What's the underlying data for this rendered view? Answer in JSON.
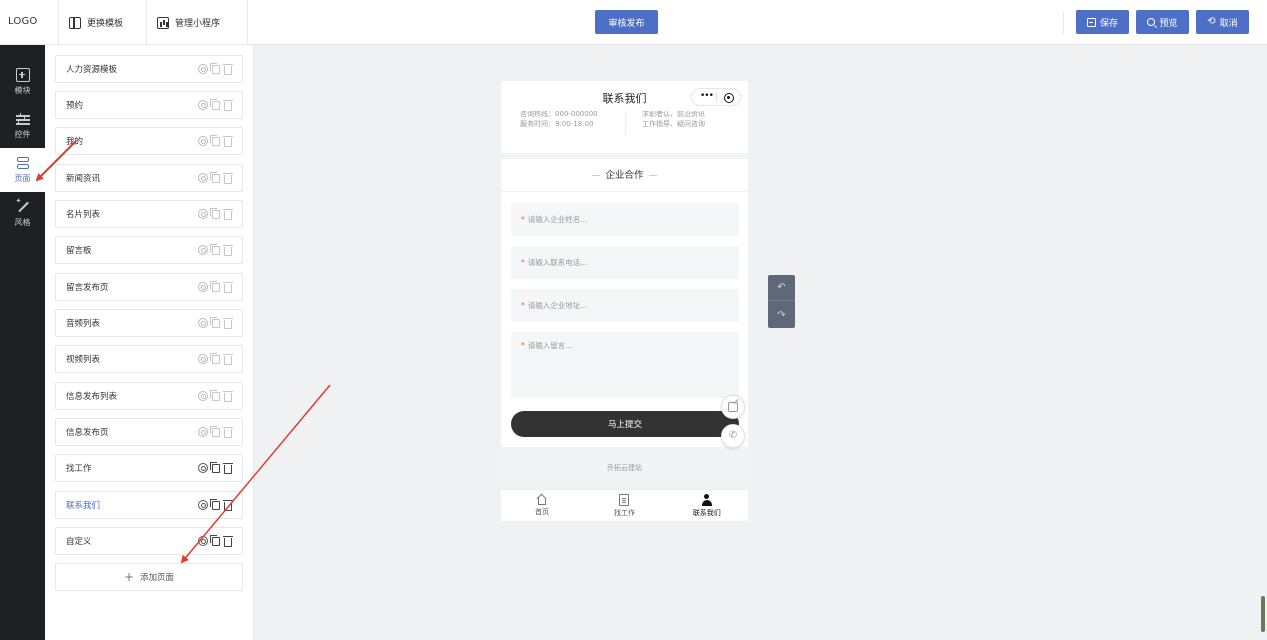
{
  "header": {
    "logo": "LOGO",
    "tabs": [
      {
        "label": "更换模板",
        "icon": "template-icon"
      },
      {
        "label": "管理小程序",
        "icon": "stats-icon"
      }
    ],
    "publish_label": "审核发布",
    "save_label": "保存",
    "preview_label": "预览",
    "cancel_label": "取消"
  },
  "rail": {
    "items": [
      {
        "label": "模块",
        "icon": "plus-box-icon"
      },
      {
        "label": "控件",
        "icon": "sliders-icon"
      },
      {
        "label": "页面",
        "icon": "pages-icon",
        "active": true
      },
      {
        "label": "风格",
        "icon": "magic-wand-icon"
      }
    ]
  },
  "pages": {
    "items": [
      {
        "label": "人力资源模板"
      },
      {
        "label": "预约"
      },
      {
        "label": "我的"
      },
      {
        "label": "新闻资讯"
      },
      {
        "label": "名片列表"
      },
      {
        "label": "留言板"
      },
      {
        "label": "留言发布页"
      },
      {
        "label": "音频列表"
      },
      {
        "label": "视频列表"
      },
      {
        "label": "信息发布列表"
      },
      {
        "label": "信息发布页"
      },
      {
        "label": "找工作"
      },
      {
        "label": "联系我们",
        "active": true
      },
      {
        "label": "自定义"
      }
    ],
    "add_label": "添加页面"
  },
  "phone": {
    "title": "联系我们",
    "info_left": [
      "咨询热线：000-000000",
      "服务时间：9:00-18:00"
    ],
    "info_right": [
      "求职者认、前沿资讯",
      "工作指导、疑问咨询"
    ],
    "section_title": "企业合作",
    "fields": [
      {
        "placeholder": "请输入企业姓名..."
      },
      {
        "placeholder": "请输入联系电话..."
      },
      {
        "placeholder": "请输入企业地址..."
      },
      {
        "placeholder": "请输入留言..."
      }
    ],
    "submit_label": "马上提交",
    "footer_text": "乔拓云建站",
    "tabbar": [
      {
        "label": "首页",
        "icon": "home-icon"
      },
      {
        "label": "找工作",
        "icon": "document-icon"
      },
      {
        "label": "联系我们",
        "icon": "user-icon",
        "active": true
      }
    ]
  },
  "colors": {
    "accent": "#4e6fc6",
    "rail_bg": "#1f2023",
    "annotation_arrow": "#e03c31"
  }
}
